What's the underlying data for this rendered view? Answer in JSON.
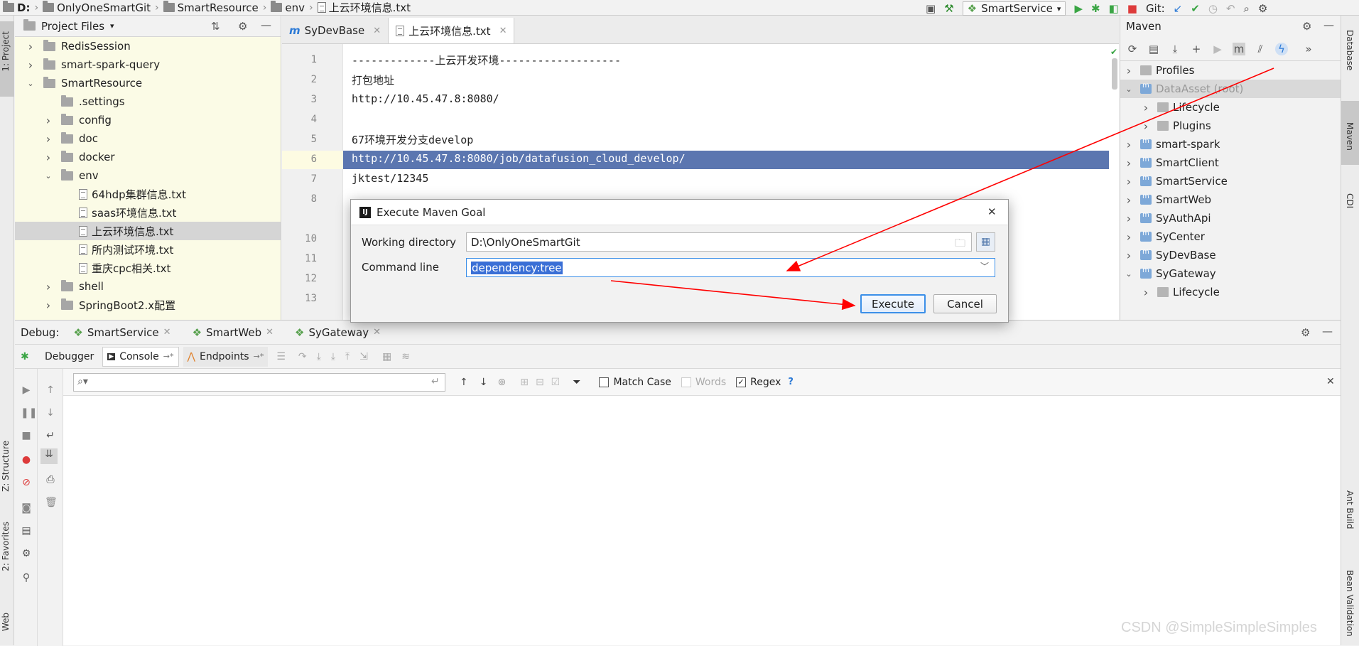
{
  "navbar": {
    "drive": "D:",
    "crumbs": [
      "OnlyOneSmartGit",
      "SmartResource",
      "env"
    ],
    "file": "上云环境信息.txt",
    "run_config": "SmartService",
    "git_label": "Git:"
  },
  "left_strip": {
    "project": "1: Project",
    "structure": "Z: Structure",
    "favorites": "2: Favorites",
    "web": "Web"
  },
  "right_strip": {
    "database": "Database",
    "maven": "Maven",
    "cdi": "CDI",
    "ant": "Ant Build",
    "bean": "Bean Validation"
  },
  "project": {
    "header": "Project Files",
    "items": [
      {
        "label": "RedisSession",
        "type": "folder",
        "depth": 1,
        "expanded": false
      },
      {
        "label": "smart-spark-query",
        "type": "folder",
        "depth": 1,
        "expanded": false
      },
      {
        "label": "SmartResource",
        "type": "folder",
        "depth": 1,
        "expanded": true
      },
      {
        "label": ".settings",
        "type": "folder",
        "depth": 2,
        "expanded": null
      },
      {
        "label": "config",
        "type": "folder",
        "depth": 2,
        "expanded": false
      },
      {
        "label": "doc",
        "type": "folder",
        "depth": 2,
        "expanded": false
      },
      {
        "label": "docker",
        "type": "folder",
        "depth": 2,
        "expanded": false
      },
      {
        "label": "env",
        "type": "folder",
        "depth": 2,
        "expanded": true
      },
      {
        "label": "64hdp集群信息.txt",
        "type": "file",
        "depth": 3
      },
      {
        "label": "saas环境信息.txt",
        "type": "file",
        "depth": 3
      },
      {
        "label": "上云环境信息.txt",
        "type": "file",
        "depth": 3,
        "selected": true
      },
      {
        "label": "所内测试环境.txt",
        "type": "file",
        "depth": 3
      },
      {
        "label": "重庆cpc相关.txt",
        "type": "file",
        "depth": 3
      },
      {
        "label": "shell",
        "type": "folder",
        "depth": 2,
        "expanded": false
      },
      {
        "label": "SpringBoot2.x配置",
        "type": "folder",
        "depth": 2,
        "expanded": false
      }
    ]
  },
  "editor": {
    "tabs": [
      {
        "label": "SyDevBase",
        "prefix": "m",
        "active": false
      },
      {
        "label": "上云环境信息.txt",
        "active": true
      }
    ],
    "lines": [
      {
        "n": "1",
        "text": "-------------上云开发环境-------------------"
      },
      {
        "n": "2",
        "text": "打包地址"
      },
      {
        "n": "3",
        "text": "http://10.45.47.8:8080/"
      },
      {
        "n": "4",
        "text": ""
      },
      {
        "n": "5",
        "text": "67环境开发分支develop"
      },
      {
        "n": "6",
        "text": "http://10.45.47.8:8080/job/datafusion_cloud_develop/",
        "highlight": true
      },
      {
        "n": "7",
        "text": "jktest/12345"
      },
      {
        "n": "8",
        "text": ""
      },
      {
        "n": "10",
        "text": ""
      },
      {
        "n": "11",
        "text": ""
      },
      {
        "n": "12",
        "text": ""
      },
      {
        "n": "13",
        "text": ""
      }
    ]
  },
  "maven": {
    "title": "Maven",
    "items": [
      {
        "label": "Profiles",
        "depth": 0,
        "icon": "profiles",
        "expanded": false
      },
      {
        "label": "DataAsset (root)",
        "depth": 0,
        "icon": "maven",
        "expanded": true,
        "selected": true
      },
      {
        "label": "Lifecycle",
        "depth": 1,
        "icon": "gear",
        "expanded": false
      },
      {
        "label": "Plugins",
        "depth": 1,
        "icon": "gear",
        "expanded": false
      },
      {
        "label": "smart-spark",
        "depth": 0,
        "icon": "maven",
        "expanded": false
      },
      {
        "label": "SmartClient",
        "depth": 0,
        "icon": "maven",
        "expanded": false
      },
      {
        "label": "SmartService",
        "depth": 0,
        "icon": "maven",
        "expanded": false
      },
      {
        "label": "SmartWeb",
        "depth": 0,
        "icon": "maven",
        "expanded": false
      },
      {
        "label": "SyAuthApi",
        "depth": 0,
        "icon": "maven",
        "expanded": false
      },
      {
        "label": "SyCenter",
        "depth": 0,
        "icon": "maven",
        "expanded": false
      },
      {
        "label": "SyDevBase",
        "depth": 0,
        "icon": "maven",
        "expanded": false
      },
      {
        "label": "SyGateway",
        "depth": 0,
        "icon": "maven",
        "expanded": true
      },
      {
        "label": "Lifecycle",
        "depth": 1,
        "icon": "gear",
        "expanded": false
      }
    ]
  },
  "debug": {
    "label": "Debug:",
    "tabs": [
      "SmartService",
      "SmartWeb",
      "SyGateway"
    ],
    "subtabs": {
      "debugger": "Debugger",
      "console": "Console",
      "endpoints": "Endpoints"
    },
    "search_placeholder": "",
    "match_case": "Match Case",
    "words": "Words",
    "regex": "Regex",
    "help": "?"
  },
  "dialog": {
    "title": "Execute Maven Goal",
    "working_dir_label": "Working directory",
    "working_dir_value": "D:\\OnlyOneSmartGit",
    "command_label": "Command line",
    "command_value": "dependency:tree",
    "execute": "Execute",
    "cancel": "Cancel"
  },
  "watermark": "CSDN @SimpleSimpleSimples",
  "colors": {
    "selection_blue": "#5b76b0",
    "project_bg": "#fbfbe6",
    "arrow_red": "#ff0000",
    "primary_border": "#3b8fe8"
  }
}
